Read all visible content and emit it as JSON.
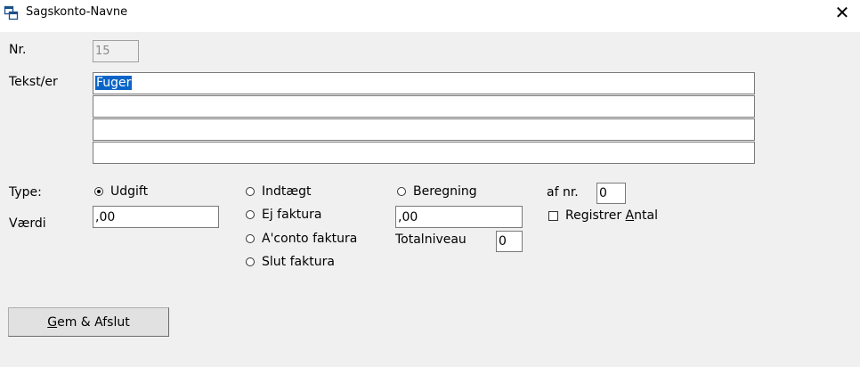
{
  "window": {
    "title": "Sagskonto-Navne",
    "close_label": "✕",
    "icon": "app-window-icon"
  },
  "form": {
    "nr_label": "Nr.",
    "nr_value": "15",
    "tekst_label": "Tekst/er",
    "tekst_lines": [
      "Fuger",
      "",
      "",
      ""
    ],
    "type_label": "Type:",
    "vaerdi_label": "Værdi",
    "vaerdi_value": ",00",
    "radios": [
      {
        "id": "udgift",
        "label": "Udgift",
        "selected": true
      },
      {
        "id": "indtaegt",
        "label": "Indtægt",
        "selected": false
      },
      {
        "id": "ej-faktura",
        "label": "Ej faktura",
        "selected": false
      },
      {
        "id": "aconto-faktura",
        "label": "A'conto faktura",
        "selected": false
      },
      {
        "id": "slut-faktura",
        "label": "Slut faktura",
        "selected": false
      },
      {
        "id": "beregning",
        "label": "Beregning",
        "selected": false
      }
    ],
    "beregning_value": ",00",
    "totalniveau_label": "Totalniveau",
    "totalniveau_value": "0",
    "af_nr_label": "af nr.",
    "af_nr_value": "0",
    "registrer_label_pre": "Registrer ",
    "registrer_label_u": "A",
    "registrer_label_post": "ntal",
    "registrer_checked": false
  },
  "buttons": {
    "save_u": "G",
    "save_rest": "em & Afslut"
  }
}
